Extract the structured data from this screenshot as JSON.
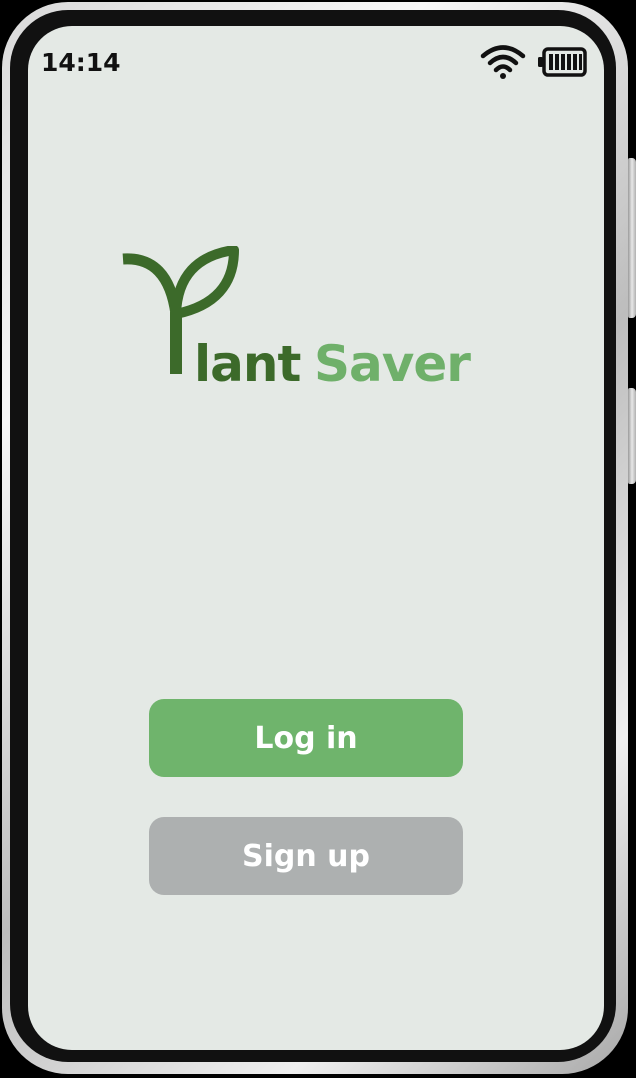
{
  "status_bar": {
    "time": "14:14",
    "icons": [
      "wifi-icon",
      "battery-icon"
    ]
  },
  "logo": {
    "icon": "sprout-icon",
    "word_1": "lant",
    "word_2": "Saver",
    "colors": {
      "dark_green": "#3c6a2a",
      "light_green": "#6fb06a"
    }
  },
  "actions": {
    "login_label": "Log in",
    "signup_label": "Sign up",
    "login_color": "#6fb46c",
    "signup_color": "#adb0b0"
  },
  "theme": {
    "screen_background": "#e4e9e5"
  }
}
